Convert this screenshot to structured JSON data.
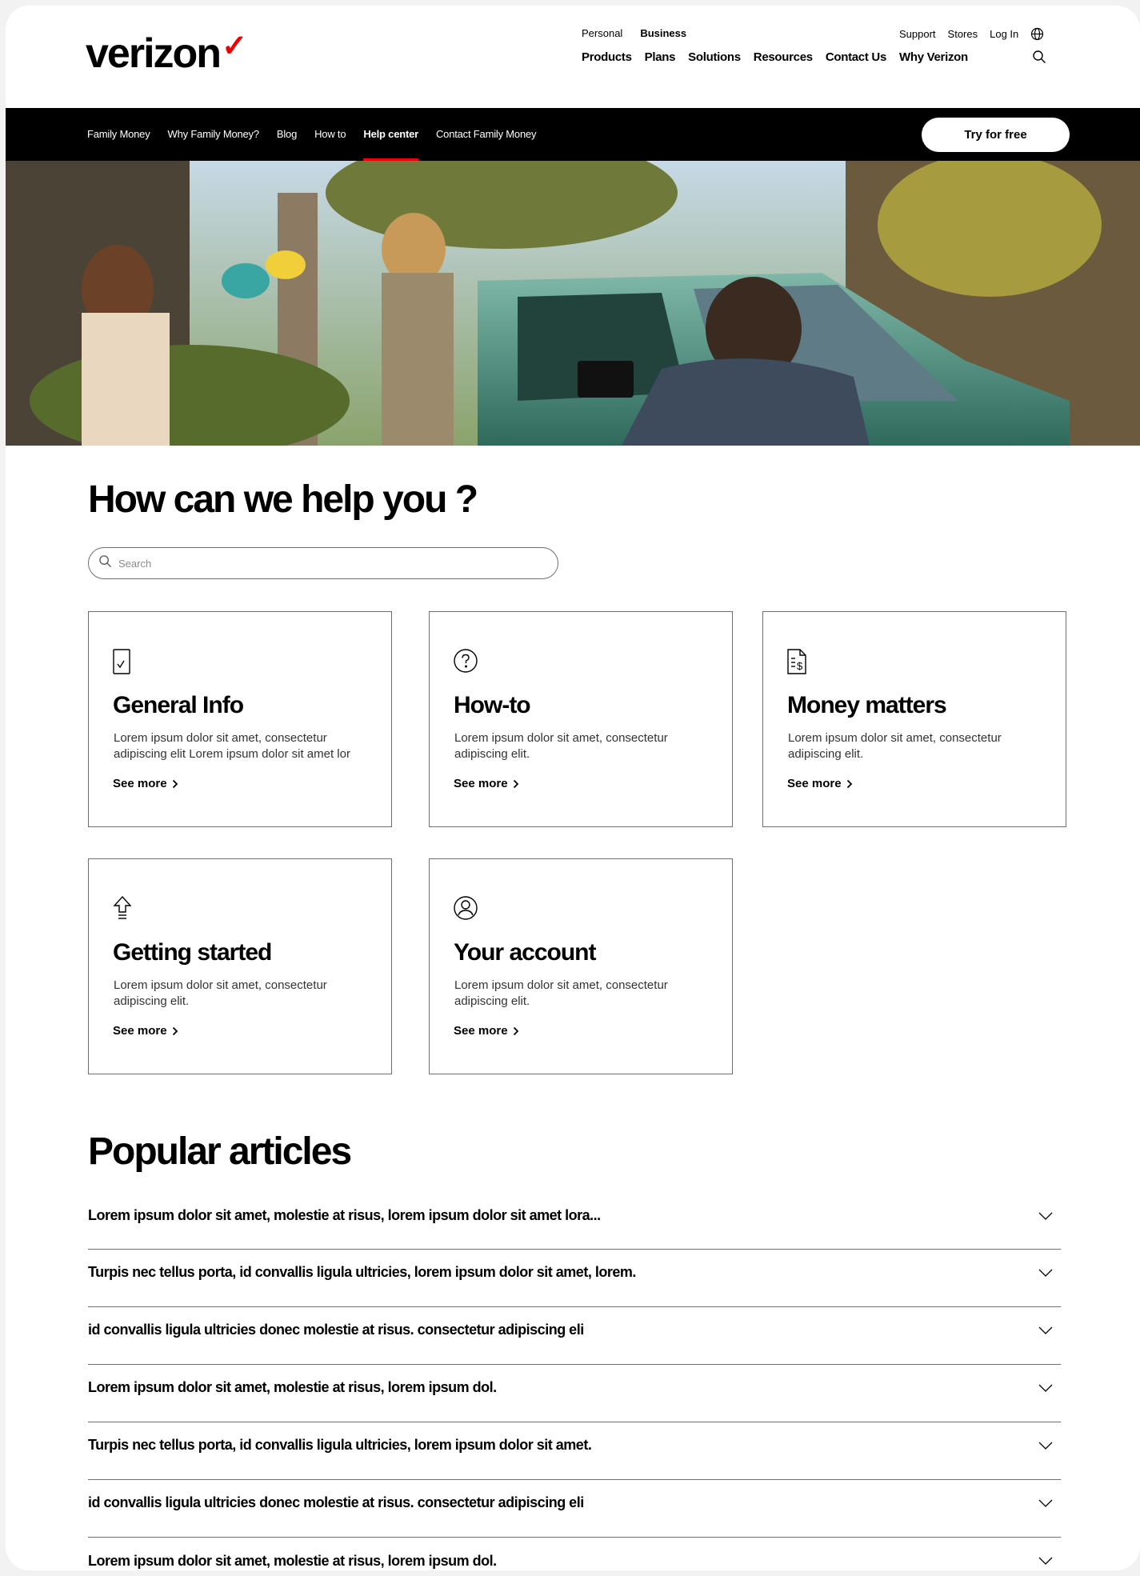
{
  "brand": {
    "logo_text": "verizon",
    "logo_mark": "✓",
    "accent": "#ee0000"
  },
  "header": {
    "segments": [
      "Personal",
      "Business"
    ],
    "main_nav": [
      "Products",
      "Plans",
      "Solutions",
      "Resources",
      "Contact Us",
      "Why Verizon"
    ],
    "utility": [
      "Support",
      "Stores",
      "Log In"
    ],
    "icons": [
      "globe-icon",
      "search-icon"
    ]
  },
  "subnav": {
    "links": [
      "Family Money",
      "Why Family Money?",
      "Blog",
      "How to",
      "Help center",
      "Contact Family Money"
    ],
    "active": "Help center",
    "cta": "Try for free"
  },
  "help": {
    "title": "How can we help you ?",
    "search_placeholder": "Search"
  },
  "cards": [
    {
      "title": "General Info",
      "text": "Lorem ipsum dolor sit amet, consectetur adipiscing elit Lorem ipsum dolor sit amet lor",
      "link": "See more",
      "icon": "tablet-check-icon"
    },
    {
      "title": "How-to",
      "text": "Lorem ipsum dolor sit amet, consectetur adipiscing elit.",
      "link": "See more",
      "icon": "question-circle-icon"
    },
    {
      "title": "Money matters",
      "text": "Lorem ipsum dolor sit amet, consectetur adipiscing elit.",
      "link": "See more",
      "icon": "invoice-dollar-icon"
    },
    {
      "title": "Getting started",
      "text": "Lorem ipsum dolor sit amet, consectetur adipiscing elit.",
      "link": "See more",
      "icon": "upload-arrow-icon"
    },
    {
      "title": "Your account",
      "text": "Lorem ipsum dolor sit amet, consectetur adipiscing elit.",
      "link": "See more",
      "icon": "user-circle-icon"
    }
  ],
  "popular": {
    "title": "Popular articles",
    "items": [
      "Lorem ipsum dolor sit amet, molestie at risus, lorem ipsum dolor sit amet lora...",
      "Turpis nec tellus porta, id convallis ligula ultricies, lorem ipsum dolor sit amet, lorem.",
      "id convallis ligula ultricies donec molestie at risus. consectetur adipiscing eli",
      "Lorem ipsum dolor sit amet, molestie at risus, lorem ipsum dol.",
      "Turpis nec tellus porta, id convallis ligula ultricies, lorem ipsum dolor sit amet.",
      "id convallis ligula ultricies donec molestie at risus. consectetur adipiscing eli",
      "Lorem ipsum dolor sit amet, molestie at risus, lorem ipsum dol."
    ]
  }
}
